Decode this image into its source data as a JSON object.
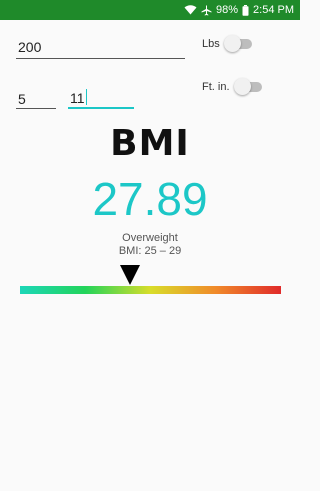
{
  "status_bar": {
    "battery": "98%",
    "time": "2:54 PM",
    "icons": [
      "wifi-icon",
      "airplane-icon",
      "battery-icon"
    ],
    "color": "#1f8a2a"
  },
  "weight": {
    "value": "200",
    "unit_label": "Lbs"
  },
  "height": {
    "feet": "5",
    "inches": "11",
    "unit_label": "Ft. in."
  },
  "result": {
    "heading": "BMI",
    "value": "27.89",
    "category": "Overweight",
    "range": "BMI: 25 – 29",
    "accent_color": "#1cc7c7"
  },
  "scale": {
    "gradient_colors": [
      "#1cd6b8",
      "#22d45a",
      "#d8dd2a",
      "#f08a2a",
      "#e02a2a"
    ],
    "indicator_fraction": 0.42
  }
}
